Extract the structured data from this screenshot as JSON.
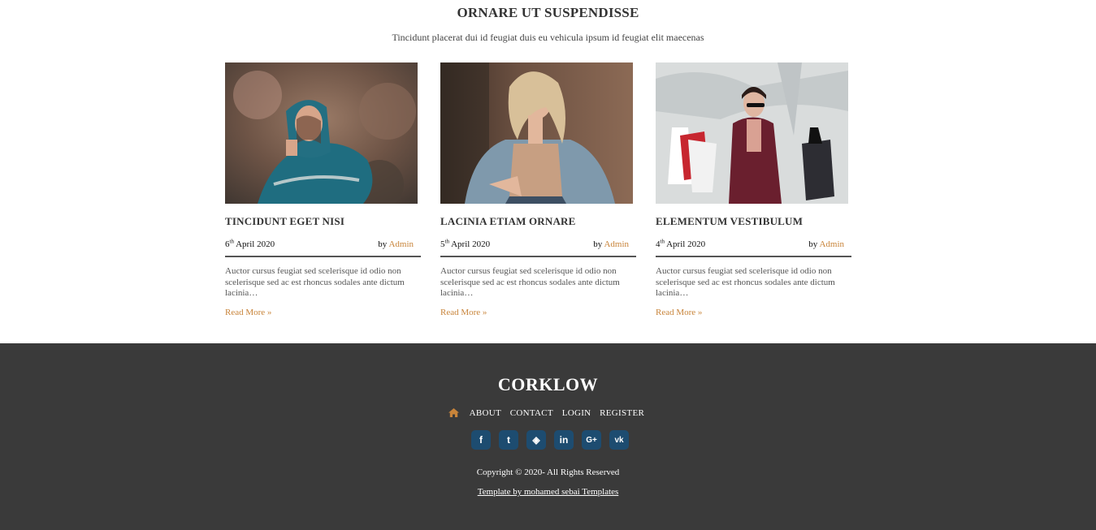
{
  "section": {
    "title": "ORNARE UT SUSPENDISSE",
    "subtitle": "Tincidunt placerat dui id feugiat duis eu vehicula ipsum id feugiat elit maecenas"
  },
  "cards": [
    {
      "title": "TINCIDUNT EGET NISI",
      "day": "6",
      "suffix": "th",
      "month_year": "April 2020",
      "by": "by",
      "author": "Admin",
      "excerpt": "Auctor cursus feugiat sed scelerisque id odio non scelerisque sed ac est rhoncus sodales ante dictum lacinia…",
      "read_more": "Read More »"
    },
    {
      "title": "LACINIA ETIAM ORNARE",
      "day": "5",
      "suffix": "th",
      "month_year": "April 2020",
      "by": "by",
      "author": "Admin",
      "excerpt": "Auctor cursus feugiat sed scelerisque id odio non scelerisque sed ac est rhoncus sodales ante dictum lacinia…",
      "read_more": "Read More »"
    },
    {
      "title": "ELEMENTUM VESTIBULUM",
      "day": "4",
      "suffix": "th",
      "month_year": "April 2020",
      "by": "by",
      "author": "Admin",
      "excerpt": "Auctor cursus feugiat sed scelerisque id odio non scelerisque sed ac est rhoncus sodales ante dictum lacinia…",
      "read_more": "Read More »"
    }
  ],
  "footer": {
    "brand": "CORKLOW",
    "nav": [
      "ABOUT",
      "CONTACT",
      "LOGIN",
      "REGISTER"
    ],
    "social": [
      {
        "icon": "facebook-icon",
        "glyph": "f"
      },
      {
        "icon": "twitter-icon",
        "glyph": "t"
      },
      {
        "icon": "codepen-icon",
        "glyph": "◈"
      },
      {
        "icon": "linkedin-icon",
        "glyph": "in"
      },
      {
        "icon": "google-plus-icon",
        "glyph": "G+"
      },
      {
        "icon": "vk-icon",
        "glyph": "vk"
      }
    ],
    "copyright": "Copyright © 2020- All Rights Reserved",
    "template_credit": "Template by mohamed sebai Templates"
  },
  "colors": {
    "accent": "#c8843a",
    "footer_bg": "#3a3a3a",
    "social_bg": "#1d4c70"
  }
}
